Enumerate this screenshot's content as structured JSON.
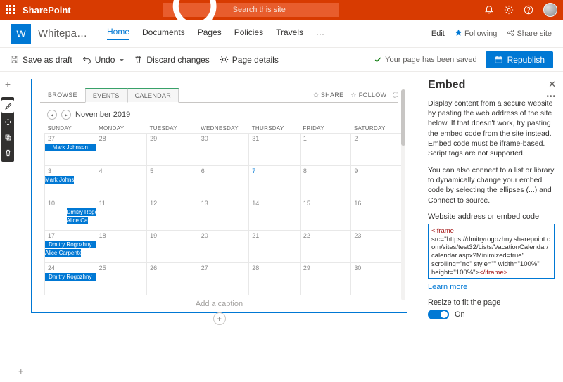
{
  "brand": {
    "product": "SharePoint",
    "search_placeholder": "Search this site"
  },
  "site": {
    "logo_letter": "W",
    "title": "Whitepape...",
    "nav": [
      "Home",
      "Documents",
      "Pages",
      "Policies",
      "Travels"
    ],
    "edit": "Edit",
    "following": "Following",
    "share": "Share site"
  },
  "cmd": {
    "save_draft": "Save as draft",
    "undo": "Undo",
    "discard": "Discard changes",
    "page_details": "Page details",
    "saved_msg": "Your page has been saved",
    "republish": "Republish"
  },
  "calendar": {
    "tabs": [
      "BROWSE",
      "EVENTS",
      "CALENDAR"
    ],
    "share": "SHARE",
    "follow": "FOLLOW",
    "month": "November 2019",
    "dow": [
      "SUNDAY",
      "MONDAY",
      "TUESDAY",
      "WEDNESDAY",
      "THURSDAY",
      "FRIDAY",
      "SATURDAY"
    ],
    "weeks": [
      [
        "27",
        "28",
        "29",
        "30",
        "31",
        "1",
        "2"
      ],
      [
        "3",
        "4",
        "5",
        "6",
        "7",
        "8",
        "9"
      ],
      [
        "10",
        "11",
        "12",
        "13",
        "14",
        "15",
        "16"
      ],
      [
        "17",
        "18",
        "19",
        "20",
        "21",
        "22",
        "23"
      ],
      [
        "24",
        "25",
        "26",
        "27",
        "28",
        "29",
        "30"
      ]
    ],
    "today": "7",
    "events": {
      "mark1": "Mark Johnson",
      "mark2": "Mark Johnson",
      "dmitry1": "Dmitry Rogozhny",
      "alice1": "Alice Carpenter",
      "dmitry2": "Dmitry Rogozhny",
      "alice2": "Alice Carpenter",
      "dmitry3": "Dmitry Rogozhny"
    },
    "caption": "Add a caption"
  },
  "panel": {
    "title": "Embed",
    "desc1": "Display content from a secure website by pasting the web address of the site below. If that doesn't work, try pasting the embed code from the site instead. Embed code must be iframe-based. Script tags are not supported.",
    "desc2": "You can also connect to a list or library to dynamically change your embed code by selecting the ellipses (...) and Connect to source.",
    "field_label": "Website address or embed code",
    "embed_open": "<iframe",
    "embed_body": " src=\"https://dmitryrogozhny.sharepoint.com/sites/test32/Lists/VacationCalendar/calendar.aspx?Minimized=true\" scrolling=\"no\" style=\"\" width=\"100%\" height=\"100%\">",
    "embed_close": "</iframe>",
    "learn_more": "Learn more",
    "resize_label": "Resize to fit the page",
    "toggle_state": "On"
  }
}
